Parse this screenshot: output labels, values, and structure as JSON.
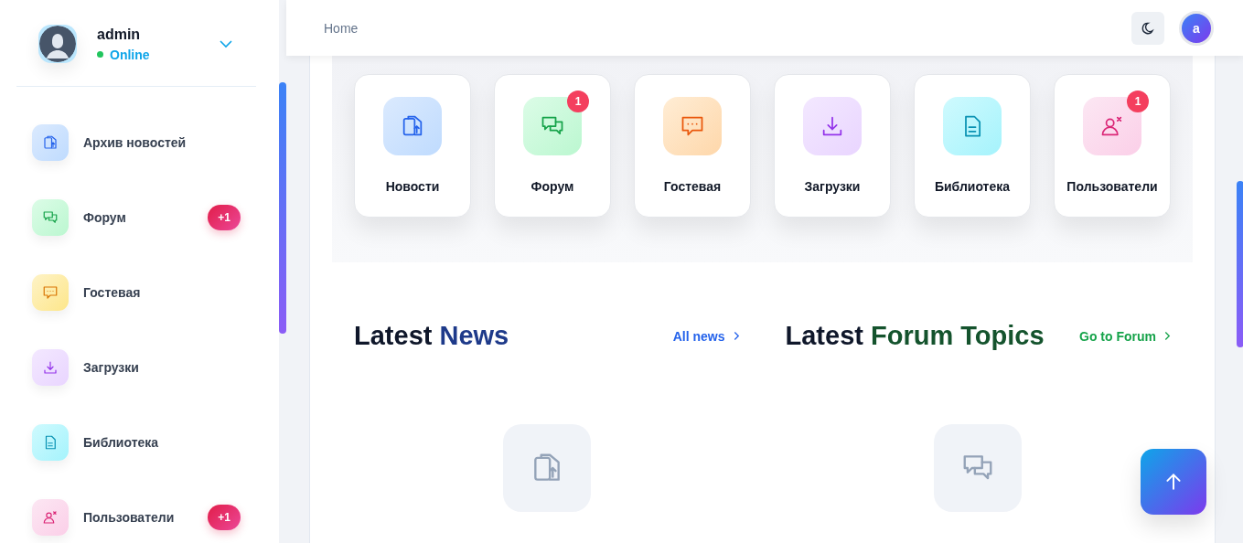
{
  "user": {
    "name": "admin",
    "status": "Online",
    "online": true
  },
  "sidebar": {
    "items": [
      {
        "label": "Архив новостей",
        "kind": "news"
      },
      {
        "label": "Форум",
        "kind": "forum",
        "badge": "+1"
      },
      {
        "label": "Гостевая",
        "kind": "guestbook"
      },
      {
        "label": "Загрузки",
        "kind": "downloads"
      },
      {
        "label": "Библиотека",
        "kind": "library"
      },
      {
        "label": "Пользователи",
        "kind": "users",
        "badge": "+1"
      }
    ]
  },
  "header": {
    "breadcrumb": "Home",
    "avatar_letter": "a"
  },
  "tiles": [
    {
      "label": "Новости",
      "kind": "news"
    },
    {
      "label": "Форум",
      "kind": "forum",
      "badge": "1"
    },
    {
      "label": "Гостевая",
      "kind": "guestbook"
    },
    {
      "label": "Загрузки",
      "kind": "downloads"
    },
    {
      "label": "Библиотека",
      "kind": "library"
    },
    {
      "label": "Пользователи",
      "kind": "users",
      "badge": "1"
    }
  ],
  "sections": [
    {
      "title_lead": "Latest",
      "title_accent": "News",
      "link": "All news",
      "kind": "news"
    },
    {
      "title_lead": "Latest",
      "title_accent": "Forum Topics",
      "link": "Go to Forum",
      "kind": "forum"
    }
  ]
}
